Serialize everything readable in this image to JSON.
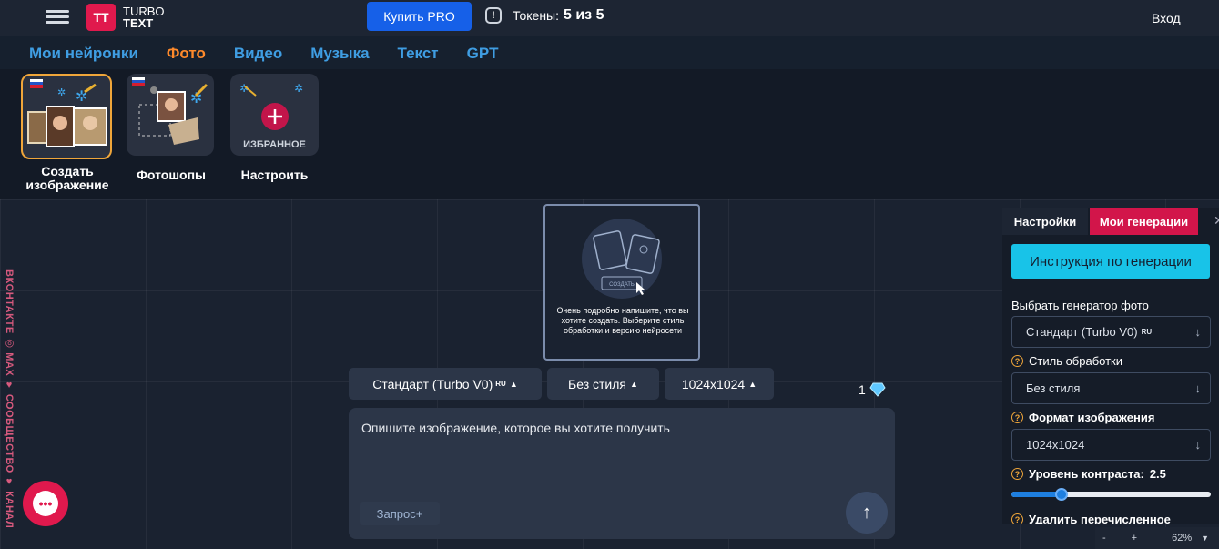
{
  "header": {
    "logo_mark": "TT",
    "logo_line1": "TURBO",
    "logo_line2": "TEXT",
    "pro_button": "Купить PRO",
    "tokens_label": "Токены:",
    "tokens_value": "5 из 5",
    "login": "Вход"
  },
  "nav": {
    "tabs": [
      {
        "label": "Мои нейронки"
      },
      {
        "label": "Фото",
        "active": true
      },
      {
        "label": "Видео"
      },
      {
        "label": "Музыка"
      },
      {
        "label": "Текст"
      },
      {
        "label": "GPT"
      }
    ]
  },
  "tools": [
    {
      "label": "Создать изображение"
    },
    {
      "label": "Фотошопы"
    },
    {
      "label": "Настроить",
      "badge": "ИЗБРАННОЕ"
    }
  ],
  "social": {
    "vertical_text": "ВКОНТАКТЕ ◎ MAX ♥ СООБЩЕСТВО ♥ КАНАЛ"
  },
  "preview": {
    "create_label": "СОЗДАТЬ",
    "text": "Очень подробно напишите, что вы хотите создать. Выберите стиль обработки и версию нейросети"
  },
  "selectors": {
    "model": "Стандарт (Turbo V0)",
    "model_tag": "RU",
    "style": "Без стиля",
    "size": "1024x1024"
  },
  "cost": {
    "value": "1",
    "icon": "diamond-icon"
  },
  "prompt": {
    "placeholder": "Опишите изображение, которое вы хотите получить",
    "query_button": "Запрос+"
  },
  "panel": {
    "tab_settings": "Настройки",
    "tab_generations": "Мои генерации",
    "instruction_button": "Инструкция по генерации",
    "generator_label": "Выбрать генератор фото",
    "generator_value": "Стандарт (Turbo V0)",
    "generator_tag": "RU",
    "style_label": "Стиль обработки",
    "style_value": "Без стиля",
    "format_label": "Формат изображения",
    "format_value": "1024x1024",
    "contrast_label": "Уровень контраста:",
    "contrast_value": "2.5",
    "contrast_fraction": 0.25,
    "remove_label": "Удалить перечисленное"
  },
  "zoom": {
    "minus": "-",
    "plus": "+",
    "level": "62%"
  },
  "colors": {
    "accent": "#e0194d",
    "primary": "#1660e8",
    "active_tab": "#ff8a2b",
    "link": "#3f9de2"
  }
}
